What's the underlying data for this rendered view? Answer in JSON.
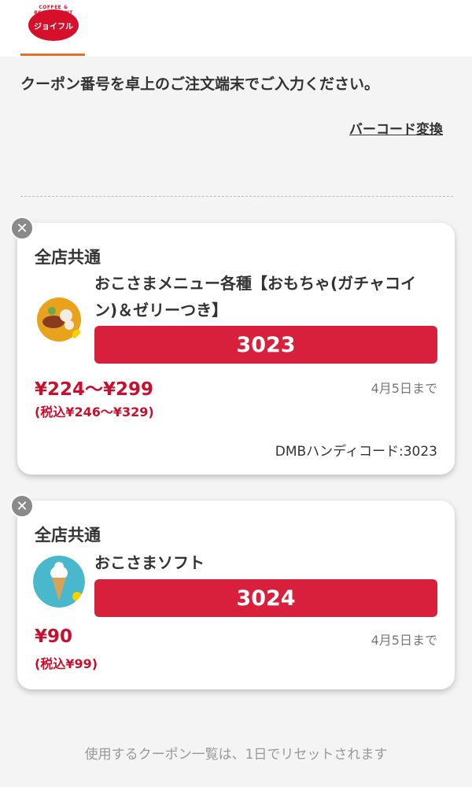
{
  "header": {
    "logo_top_text": "COFFEE & RESTAURANT",
    "logo_text": "ジョイフル",
    "logo_color": "#d6102a",
    "tab_accent_color": "#e86f2a"
  },
  "instruction": "クーポン番号を卓上のご注文端末でご入力ください。",
  "barcode_link": "バーコード変換",
  "coupons": [
    {
      "store": "全店共通",
      "name": "おこさまメニュー各種【おもちゃ(ガチャコイン)＆ゼリーつき】",
      "code": "3023",
      "price": "¥224〜¥299",
      "price_tax": "(税込¥246〜¥329)",
      "expiry": "4月5日まで",
      "dmb_code": "DMBハンディコード:3023"
    },
    {
      "store": "全店共通",
      "name": "おこさまソフト",
      "code": "3024",
      "price": "¥90",
      "price_tax": "(税込¥99)",
      "expiry": "4月5日まで"
    }
  ],
  "footer": "使用するクーポン一覧は、1日でリセットされます",
  "colors": {
    "code_box": "#d8203c",
    "price": "#c8102e",
    "close_button": "#8a8a8a"
  }
}
